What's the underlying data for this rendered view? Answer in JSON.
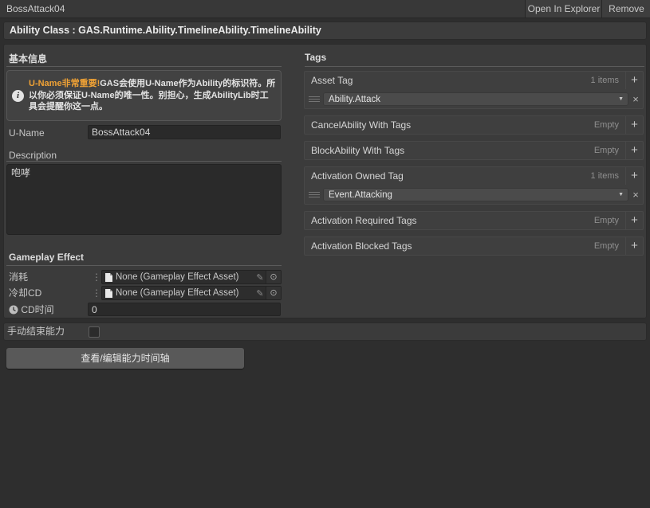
{
  "window": {
    "title": "BossAttack04",
    "open_in_explorer": "Open In Explorer",
    "remove": "Remove"
  },
  "ability_class_header": "Ability Class : GAS.Runtime.Ability.TimelineAbility.TimelineAbility",
  "basic_info": {
    "title": "基本信息",
    "notice": {
      "highlight": "U-Name非常重要!",
      "body": "GAS会使用U-Name作为Ability的标识符。所以你必须保证U-Name的唯一性。别担心，生成AbilityLib时工具会提醒你这一点。"
    },
    "u_name": {
      "label": "U-Name",
      "value": "BossAttack04"
    },
    "description": {
      "label": "Description",
      "value": "咆哮"
    }
  },
  "gameplay_effect": {
    "title": "Gameplay Effect",
    "cost": {
      "label": "消耗",
      "value": "None (Gameplay Effect Asset)"
    },
    "cooldown": {
      "label": "冷却CD",
      "value": "None (Gameplay Effect Asset)"
    },
    "cd_time": {
      "label": "CD时间",
      "value": "0"
    }
  },
  "tags": {
    "title": "Tags",
    "groups": [
      {
        "label": "Asset Tag",
        "count": "1 items",
        "items": [
          "Ability.Attack"
        ]
      },
      {
        "label": "CancelAbility With Tags",
        "count": "Empty",
        "items": []
      },
      {
        "label": "BlockAbility With Tags",
        "count": "Empty",
        "items": []
      },
      {
        "label": "Activation Owned Tag",
        "count": "1 items",
        "items": [
          "Event.Attacking"
        ]
      },
      {
        "label": "Activation Required Tags",
        "count": "Empty",
        "items": []
      },
      {
        "label": "Activation Blocked Tags",
        "count": "Empty",
        "items": []
      }
    ]
  },
  "footer": {
    "manual_end_label": "手动结束能力",
    "timeline_button": "查看/编辑能力时间轴"
  },
  "colors": {
    "info_highlight": "#F0A235"
  }
}
